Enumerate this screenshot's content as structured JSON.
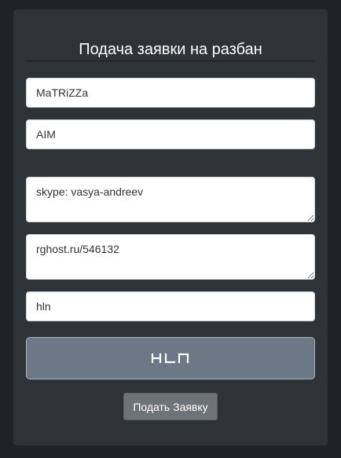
{
  "form": {
    "title": "Подача заявки на разбан",
    "fields": {
      "nickname": "MaTRiZZa",
      "weapon": "AIM",
      "contact": "skype: vasya-andreev",
      "link": "rghost.ru/546132",
      "clan": "hln"
    },
    "logo_text": "HLN",
    "submit_label": "Подать Заявку"
  },
  "colors": {
    "background": "#1e2328",
    "panel": "#2e3338",
    "logo_box": "#6c7885",
    "submit_button": "#6c7379"
  }
}
